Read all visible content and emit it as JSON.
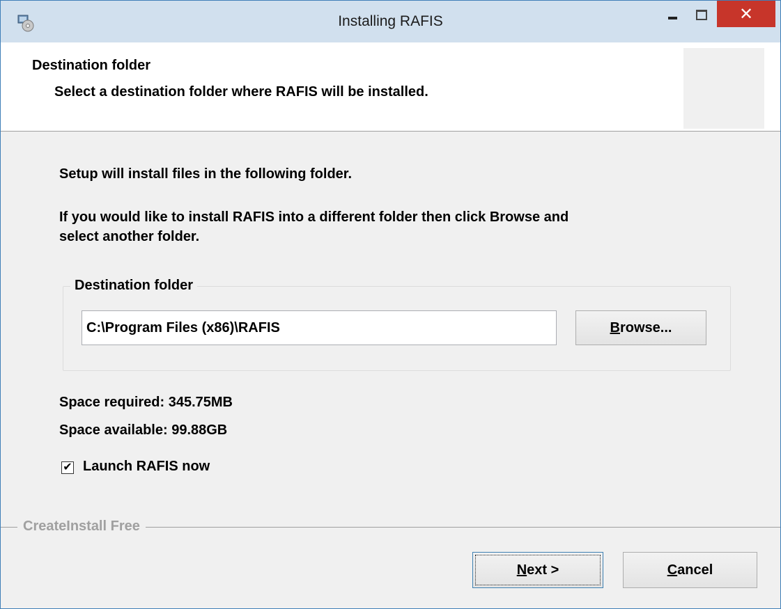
{
  "window": {
    "title": "Installing RAFIS",
    "titlebar_color": "#d1e0ee",
    "icons": {
      "app": "setup-disc-icon",
      "minimize": "minimize-icon",
      "maximize": "maximize-icon",
      "close": "close-icon"
    },
    "close_glyph": "✕"
  },
  "header": {
    "title": "Destination folder",
    "subtitle": "Select a destination folder where RAFIS will be installed."
  },
  "body": {
    "line1": "Setup will install files in the following folder.",
    "line2": "If you would like to install RAFIS into a different folder then click Browse and",
    "line3": "select another folder."
  },
  "destination": {
    "legend": "Destination folder",
    "path": "C:\\Program Files (x86)\\RAFIS",
    "browse_key": "B",
    "browse_rest": "rowse..."
  },
  "space": {
    "required": "Space required: 345.75MB",
    "available": "Space available: 99.88GB"
  },
  "launch": {
    "label": "Launch RAFIS now",
    "checked": true,
    "check_glyph": "✔"
  },
  "footer": {
    "brand": "CreateInstall Free",
    "next_key": "N",
    "next_rest": "ext >",
    "cancel_key": "C",
    "cancel_rest": "ancel"
  },
  "colors": {
    "close_button": "#c7352a",
    "accent_border": "#3c7fb1",
    "window_bg": "#f0f0f0"
  }
}
